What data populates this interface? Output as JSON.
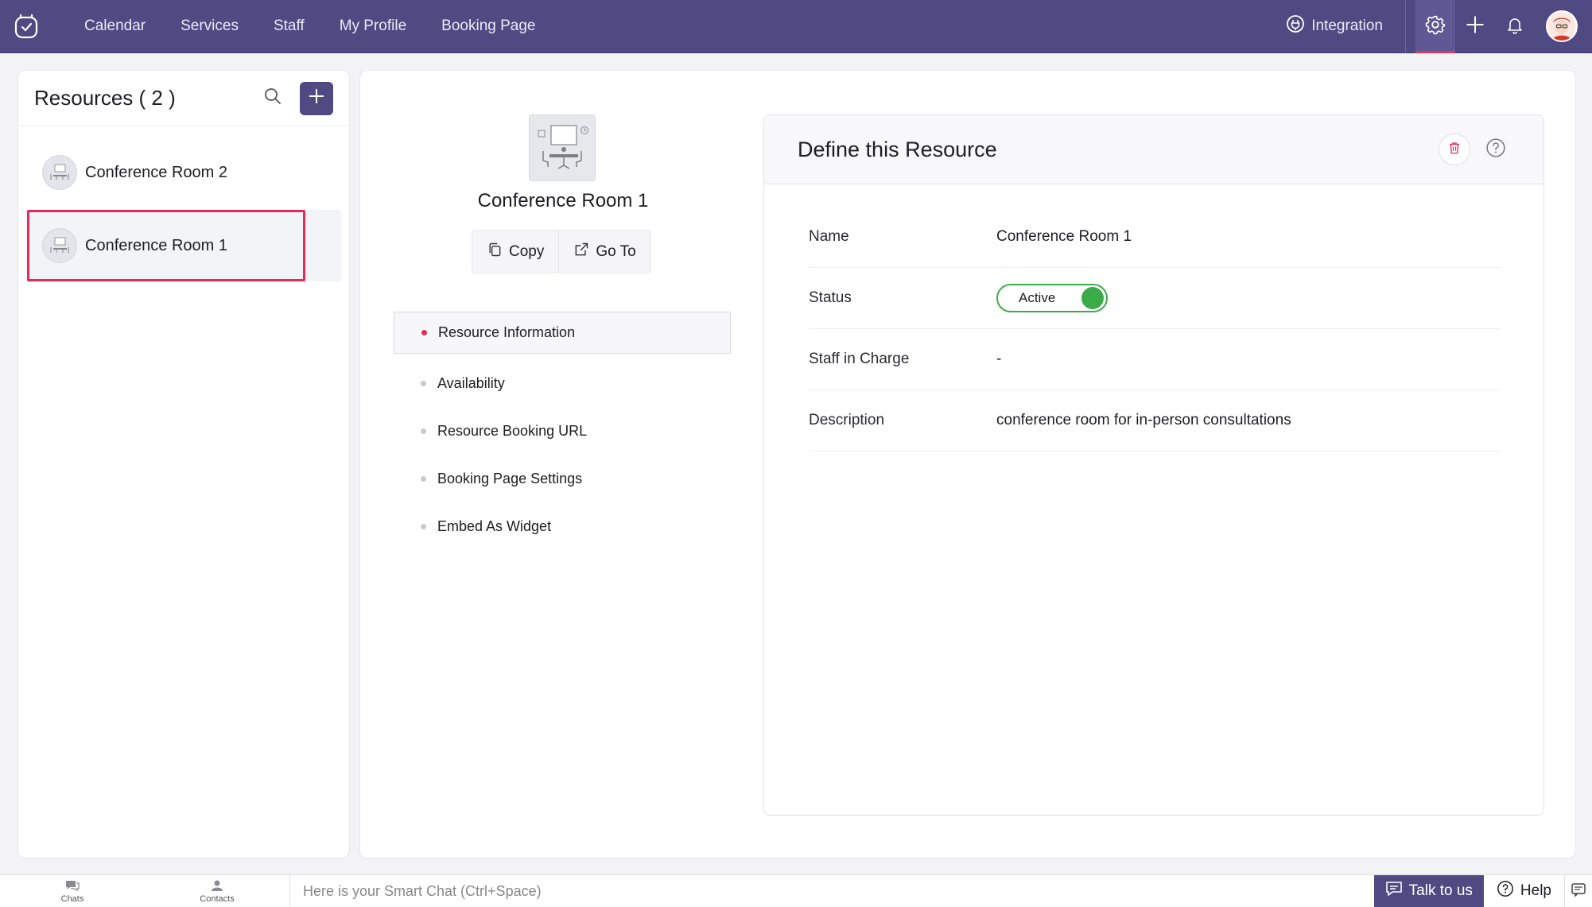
{
  "nav": {
    "items": [
      "Calendar",
      "Services",
      "Staff",
      "My Profile",
      "Booking Page"
    ],
    "integration_label": "Integration"
  },
  "resources": {
    "title": "Resources ( 2 )",
    "items": [
      {
        "name": "Conference Room 2"
      },
      {
        "name": "Conference Room 1",
        "selected": true
      }
    ]
  },
  "detail": {
    "name": "Conference Room 1",
    "copy_label": "Copy",
    "goto_label": "Go To",
    "menu": [
      "Resource Information",
      "Availability",
      "Resource Booking URL",
      "Booking Page Settings",
      "Embed As Widget"
    ]
  },
  "define": {
    "title": "Define this Resource",
    "rows": [
      {
        "label": "Name",
        "value": "Conference Room 1"
      },
      {
        "label": "Status",
        "value": "Active"
      },
      {
        "label": "Staff in Charge",
        "value": "-"
      },
      {
        "label": "Description",
        "value": "conference room for in-person consultations"
      }
    ]
  },
  "bottom": {
    "chats_label": "Chats",
    "contacts_label": "Contacts",
    "smart_chat_placeholder": "Here is your Smart Chat (Ctrl+Space)",
    "talk_label": "Talk to us",
    "help_label": "Help"
  },
  "colors": {
    "brand": "#4f4a82",
    "accent": "#e52a55",
    "active_green": "#3bab4a"
  }
}
